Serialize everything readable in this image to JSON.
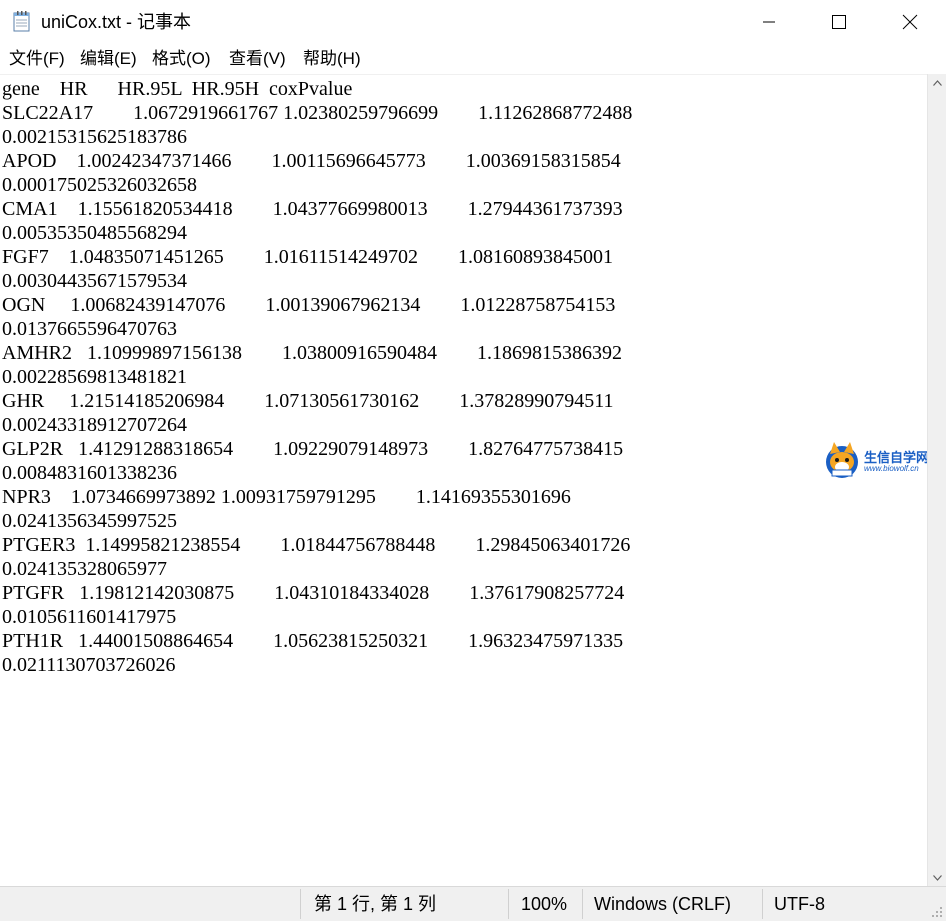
{
  "window": {
    "title": "uniCox.txt - 记事本",
    "controls": {
      "minimize_icon": "minimize-icon",
      "maximize_icon": "maximize-icon",
      "close_icon": "close-icon"
    }
  },
  "menu": {
    "file": "文件(F)",
    "edit": "编辑(E)",
    "format": "格式(O)",
    "view": "查看(V)",
    "help": "帮助(H)"
  },
  "editor": {
    "content": "gene    HR      HR.95L  HR.95H  coxPvalue\nSLC22A17        1.0672919661767 1.02380259796699        1.11262868772488\n0.00215315625183786\nAPOD    1.00242347371466        1.00115696645773        1.00369158315854\n0.000175025326032658\nCMA1    1.15561820534418        1.04377669980013        1.27944361737393\n0.00535350485568294\nFGF7    1.04835071451265        1.01611514249702        1.08160893845001\n0.00304435671579534\nOGN     1.00682439147076        1.00139067962134        1.01228758754153\n0.0137665596470763\nAMHR2   1.10999897156138        1.03800916590484        1.1869815386392\n0.00228569813481821\nGHR     1.21514185206984        1.07130561730162        1.37828990794511\n0.00243318912707264\nGLP2R   1.41291288318654        1.09229079148973        1.82764775738415\n0.0084831601338236\nNPR3    1.0734669973892 1.00931759791295        1.14169355301696\n0.0241356345997525\nPTGER3  1.14995821238554        1.01844756788448        1.29845063401726\n0.024135328065977\nPTGFR   1.19812142030875        1.04310184334028        1.37617908257724\n0.0105611601417975\nPTH1R   1.44001508864654        1.05623815250321        1.96323475971335\n0.0211130703726026"
  },
  "watermark": {
    "title": "生信自学网",
    "url": "www.biowolf.cn"
  },
  "statusbar": {
    "position": "第 1 行, 第 1 列",
    "zoom": "100%",
    "line_ending": "Windows (CRLF)",
    "encoding": "UTF-8"
  }
}
